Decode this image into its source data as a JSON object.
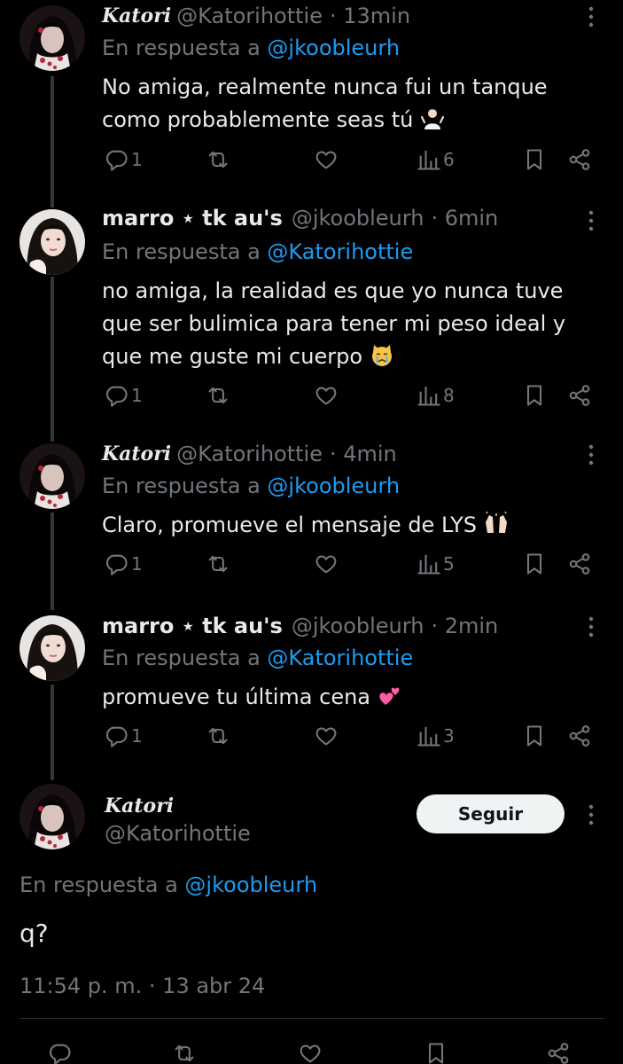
{
  "colors": {
    "background": "#000000",
    "text": "#e7e9ea",
    "muted": "#71767b",
    "link": "#1d9bf0",
    "thread_line": "#333639",
    "follow_button_bg": "#eff3f4"
  },
  "tweets": [
    {
      "display_name": "Katori",
      "handle": "@Katorihottie",
      "time": "· 13min",
      "reply_prefix": "En respuesta a",
      "reply_to": "@jkoobleurh",
      "line1": "No amiga, realmente nunca fui un tanque",
      "line2": "como probablemente seas tú",
      "line3": "",
      "emoji": "person-shrugging-emoji",
      "replies": "1",
      "views": "6"
    },
    {
      "display_name": "marro ⋆ tk au's",
      "handle": "@jkoobleurh",
      "time": "· 6min",
      "reply_prefix": "En respuesta a",
      "reply_to": "@Katorihottie",
      "line1": "no amiga, la realidad es que yo nunca tuve",
      "line2": "que ser bulimica para tener mi peso ideal y",
      "line3": "que me guste mi cuerpo",
      "emoji": "crying-cat-emoji",
      "replies": "1",
      "views": "8"
    },
    {
      "display_name": "Katori",
      "handle": "@Katorihottie",
      "time": "· 4min",
      "reply_prefix": "En respuesta a",
      "reply_to": "@jkoobleurh",
      "line1": "Claro, promueve el mensaje de LYS",
      "emoji": "raising-hands-emoji",
      "replies": "1",
      "views": "5"
    },
    {
      "display_name": "marro ⋆ tk au's",
      "handle": "@jkoobleurh",
      "time": "· 2min",
      "reply_prefix": "En respuesta a",
      "reply_to": "@Katorihottie",
      "line1": "promueve tu última cena",
      "emoji": "two-hearts-emoji",
      "replies": "1",
      "views": "3"
    }
  ],
  "main_tweet": {
    "display_name": "Katori",
    "handle": "@Katorihottie",
    "follow_label": "Seguir",
    "reply_prefix": "En respuesta a",
    "reply_to": "@jkoobleurh",
    "text": "q?",
    "timestamp": "11:54 p. m. · 13 abr 24"
  }
}
